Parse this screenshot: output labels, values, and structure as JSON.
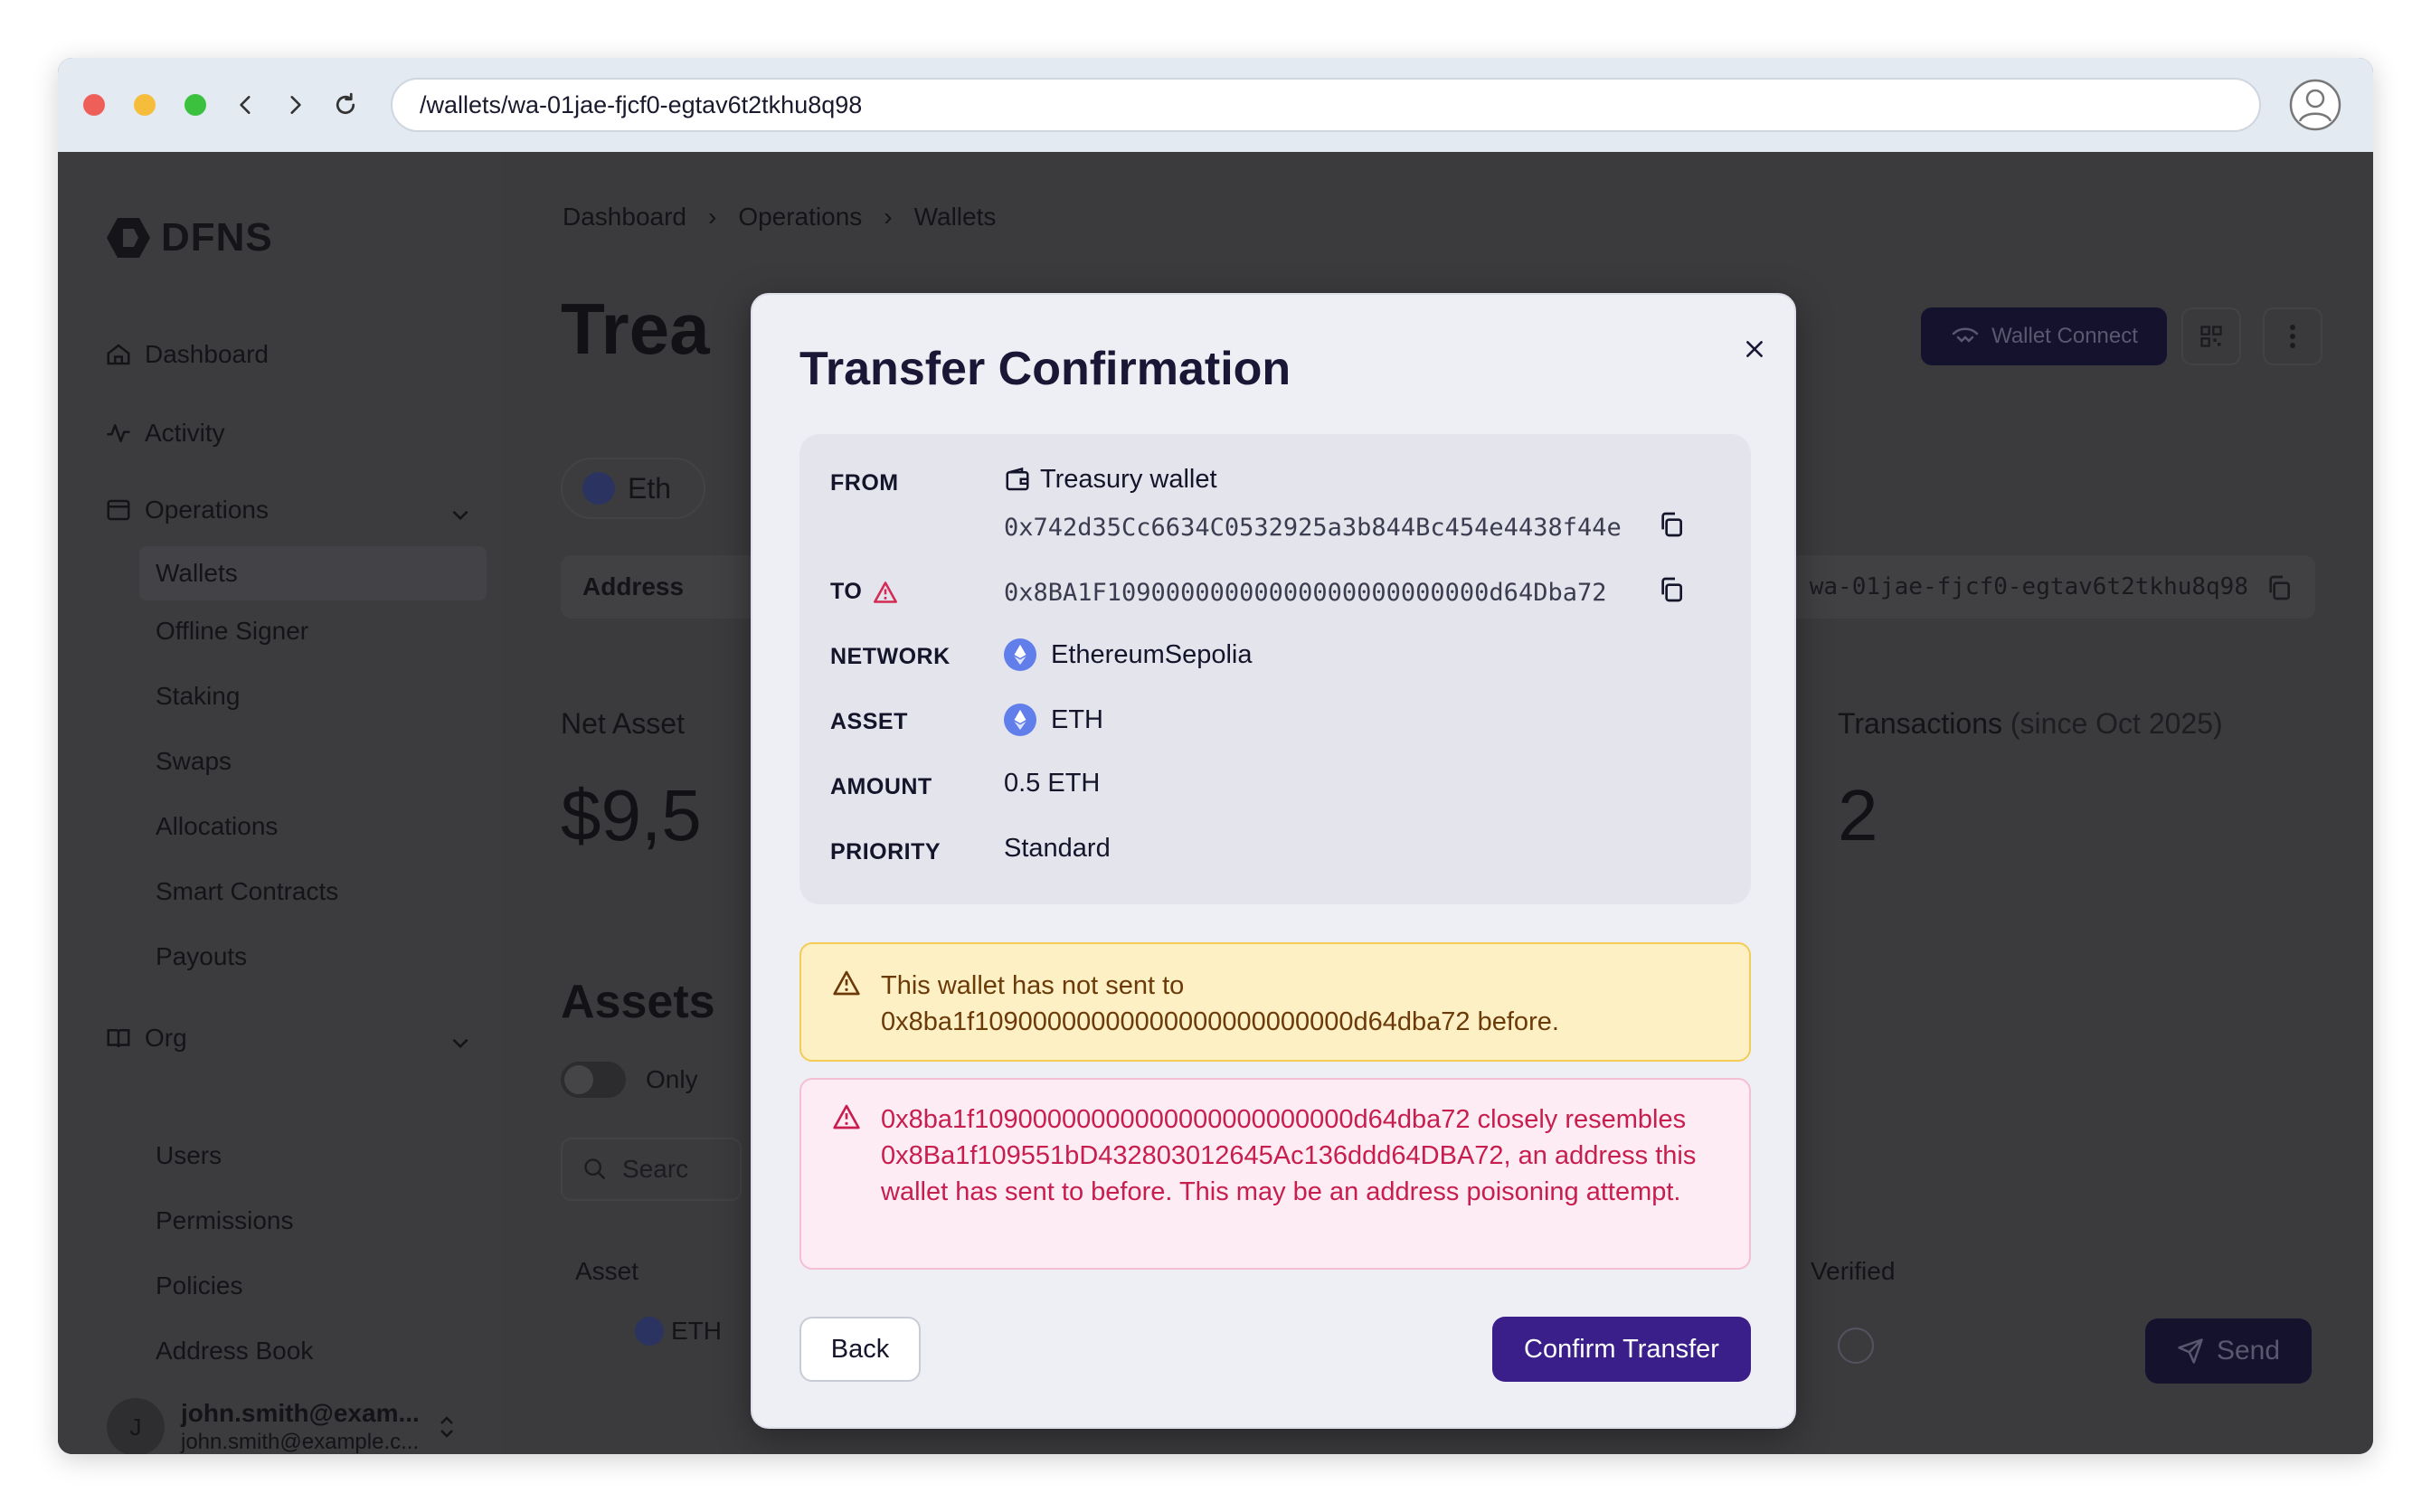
{
  "browser": {
    "url": "/wallets/wa-01jae-fjcf0-egtav6t2tkhu8q98",
    "dots": {
      "close": "#ed5f58",
      "minimize": "#f6bd3c",
      "maximize": "#3cc13f"
    }
  },
  "sidebar": {
    "logo_text": "DFNS",
    "nav": {
      "dashboard": "Dashboard",
      "activity": "Activity",
      "operations": "Operations",
      "org": "Org"
    },
    "operations_items": [
      "Wallets",
      "Offline Signer",
      "Staking",
      "Swaps",
      "Allocations",
      "Smart Contracts",
      "Payouts"
    ],
    "org_items": [
      "Users",
      "Permissions",
      "Policies",
      "Address Book"
    ],
    "user": {
      "initial": "J",
      "name": "john.smith@exam...",
      "email": "john.smith@example.c..."
    }
  },
  "main": {
    "breadcrumbs": [
      "Dashboard",
      "Operations",
      "Wallets"
    ],
    "title": "Trea",
    "wallet_connect_label": "Wallet Connect",
    "network_chip": "Eth",
    "address_label": "Address",
    "wallet_id": "wa-01jae-fjcf0-egtav6t2tkhu8q98",
    "net_asset_label": "Net Asset",
    "net_asset_value": "$9,5",
    "transactions_label": "Transactions",
    "transactions_since": "(since Oct 2025)",
    "transactions_value": "2",
    "assets_heading": "Assets",
    "toggle_label": "Only",
    "search_placeholder": "Searc",
    "table_headers": {
      "asset": "Asset",
      "verified": "Verified"
    },
    "row_asset": "ETH",
    "send_label": "Send"
  },
  "modal": {
    "title": "Transfer Confirmation",
    "labels": {
      "from": "FROM",
      "to": "TO",
      "network": "NETWORK",
      "asset": "ASSET",
      "amount": "AMOUNT",
      "priority": "PRIORITY"
    },
    "from_name": "Treasury wallet",
    "from_address": "0x742d35Cc6634C0532925a3b844Bc454e4438f44e",
    "to_address": "0x8BA1F10900000000000000000000000d64Dba72",
    "network": "EthereumSepolia",
    "asset": "ETH",
    "amount": "0.5 ETH",
    "priority": "Standard",
    "warning_line1": "This wallet has not sent to",
    "warning_line2": "0x8ba1f10900000000000000000000000d64dba72 before.",
    "error_text": "0x8ba1f10900000000000000000000000d64dba72 closely resembles 0x8Ba1f109551bD432803012645Ac136ddd64DBA72, an address this wallet has sent to before. This may be an address poisoning attempt.",
    "back_label": "Back",
    "confirm_label": "Confirm Transfer",
    "colors": {
      "confirm": "#3a1f8a",
      "warning_bg": "#fdf0c4",
      "error_text": "#c81e4f",
      "eth": "#627eea"
    }
  }
}
